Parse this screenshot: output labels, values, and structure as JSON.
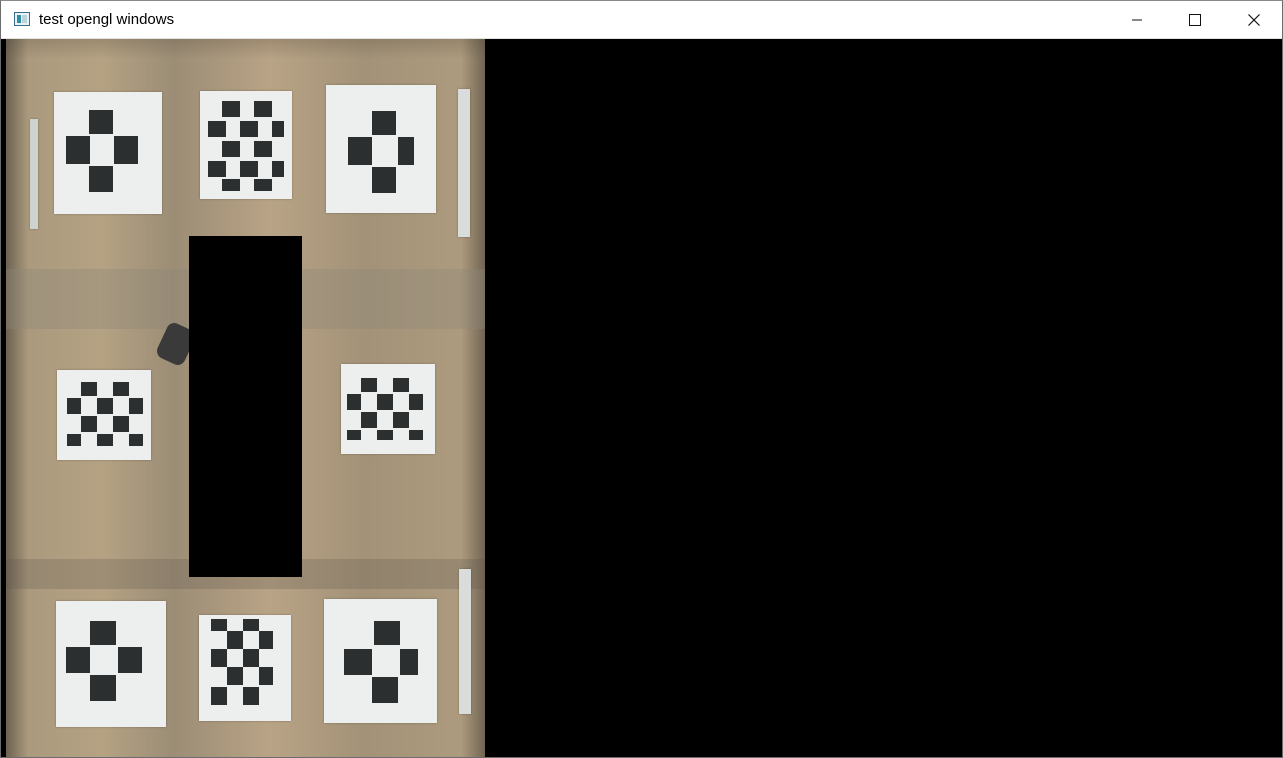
{
  "window": {
    "title": "test opengl windows",
    "controls": {
      "minimize": "minimize-icon",
      "maximize": "maximize-icon",
      "close": "close-icon"
    }
  },
  "viewport": {
    "background": "#000000",
    "rendered_scene": "camera-top-view-with-checkerboards"
  }
}
